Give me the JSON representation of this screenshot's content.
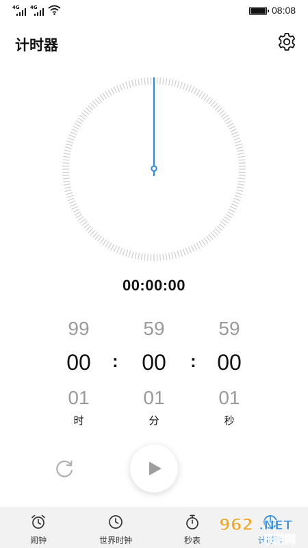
{
  "status_bar": {
    "sim1_tag": "4G",
    "sim2_tag": "4G",
    "time": "08:08"
  },
  "header": {
    "title": "计时器",
    "settings_icon": "gear-icon"
  },
  "timer": {
    "readout": "00:00:00"
  },
  "picker": {
    "hours": {
      "prev": "99",
      "current": "00",
      "next": "01",
      "unit": "时"
    },
    "minutes": {
      "prev": "59",
      "current": "00",
      "next": "01",
      "unit": "分"
    },
    "seconds": {
      "prev": "59",
      "current": "00",
      "next": "01",
      "unit": "秒"
    },
    "separator": ":"
  },
  "controls": {
    "reset_icon": "reset-icon",
    "play_icon": "play-icon"
  },
  "bottom_nav": {
    "items": [
      {
        "label": "闹钟",
        "icon": "alarm-clock-icon"
      },
      {
        "label": "世界时钟",
        "icon": "clock-icon"
      },
      {
        "label": "秒表",
        "icon": "stopwatch-icon"
      },
      {
        "label": "计时器",
        "icon": "timer-icon",
        "active": true
      }
    ]
  },
  "watermark": {
    "top_text": "962.NET",
    "bottom_text": "乐游网"
  },
  "colors": {
    "accent": "#2a8be0",
    "tick": "#c8c8c8",
    "nav_bg": "#f2f2f2"
  }
}
